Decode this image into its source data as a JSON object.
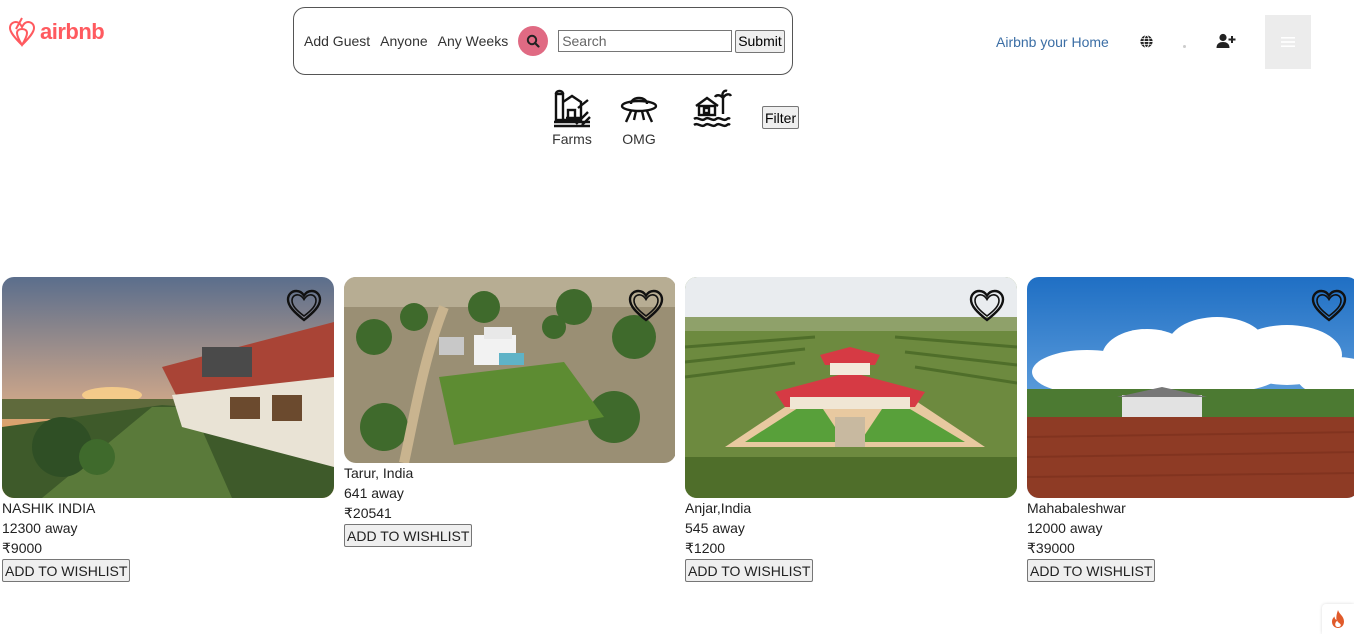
{
  "brand": {
    "name": "airbnb",
    "color": "#ff5a5f"
  },
  "search": {
    "add_guest": "Add Guest",
    "anyone": "Anyone",
    "any_weeks": "Any Weeks",
    "placeholder": "Search",
    "submit_label": "Submit",
    "icon": "search-icon"
  },
  "header": {
    "host_link": "Airbnb your Home",
    "globe_icon": "globe-icon",
    "user_icon": "user-plus-icon",
    "menu_icon": "hamburger-menu-icon"
  },
  "categories": [
    {
      "label": "Farms",
      "icon": "farm-icon"
    },
    {
      "label": "OMG",
      "icon": "ufo-icon"
    },
    {
      "label": "",
      "icon": "beach-house-icon"
    }
  ],
  "filter_label": "Filter",
  "listings": [
    {
      "location": "NASHIK INDIA",
      "distance": "12300 away",
      "price": "₹9000",
      "wishlist_label": "ADD TO WISHLIST"
    },
    {
      "location": "Tarur, India",
      "distance": "641 away",
      "price": "₹20541",
      "wishlist_label": "ADD TO WISHLIST"
    },
    {
      "location": "Anjar,India",
      "distance": "545 away",
      "price": "₹1200",
      "wishlist_label": "ADD TO WISHLIST"
    },
    {
      "location": "Mahabaleshwar",
      "distance": "12000 away",
      "price": "₹39000",
      "wishlist_label": "ADD TO WISHLIST"
    }
  ],
  "colors": {
    "accent_pink": "#e06a83",
    "link_blue": "#3b6ea5"
  }
}
